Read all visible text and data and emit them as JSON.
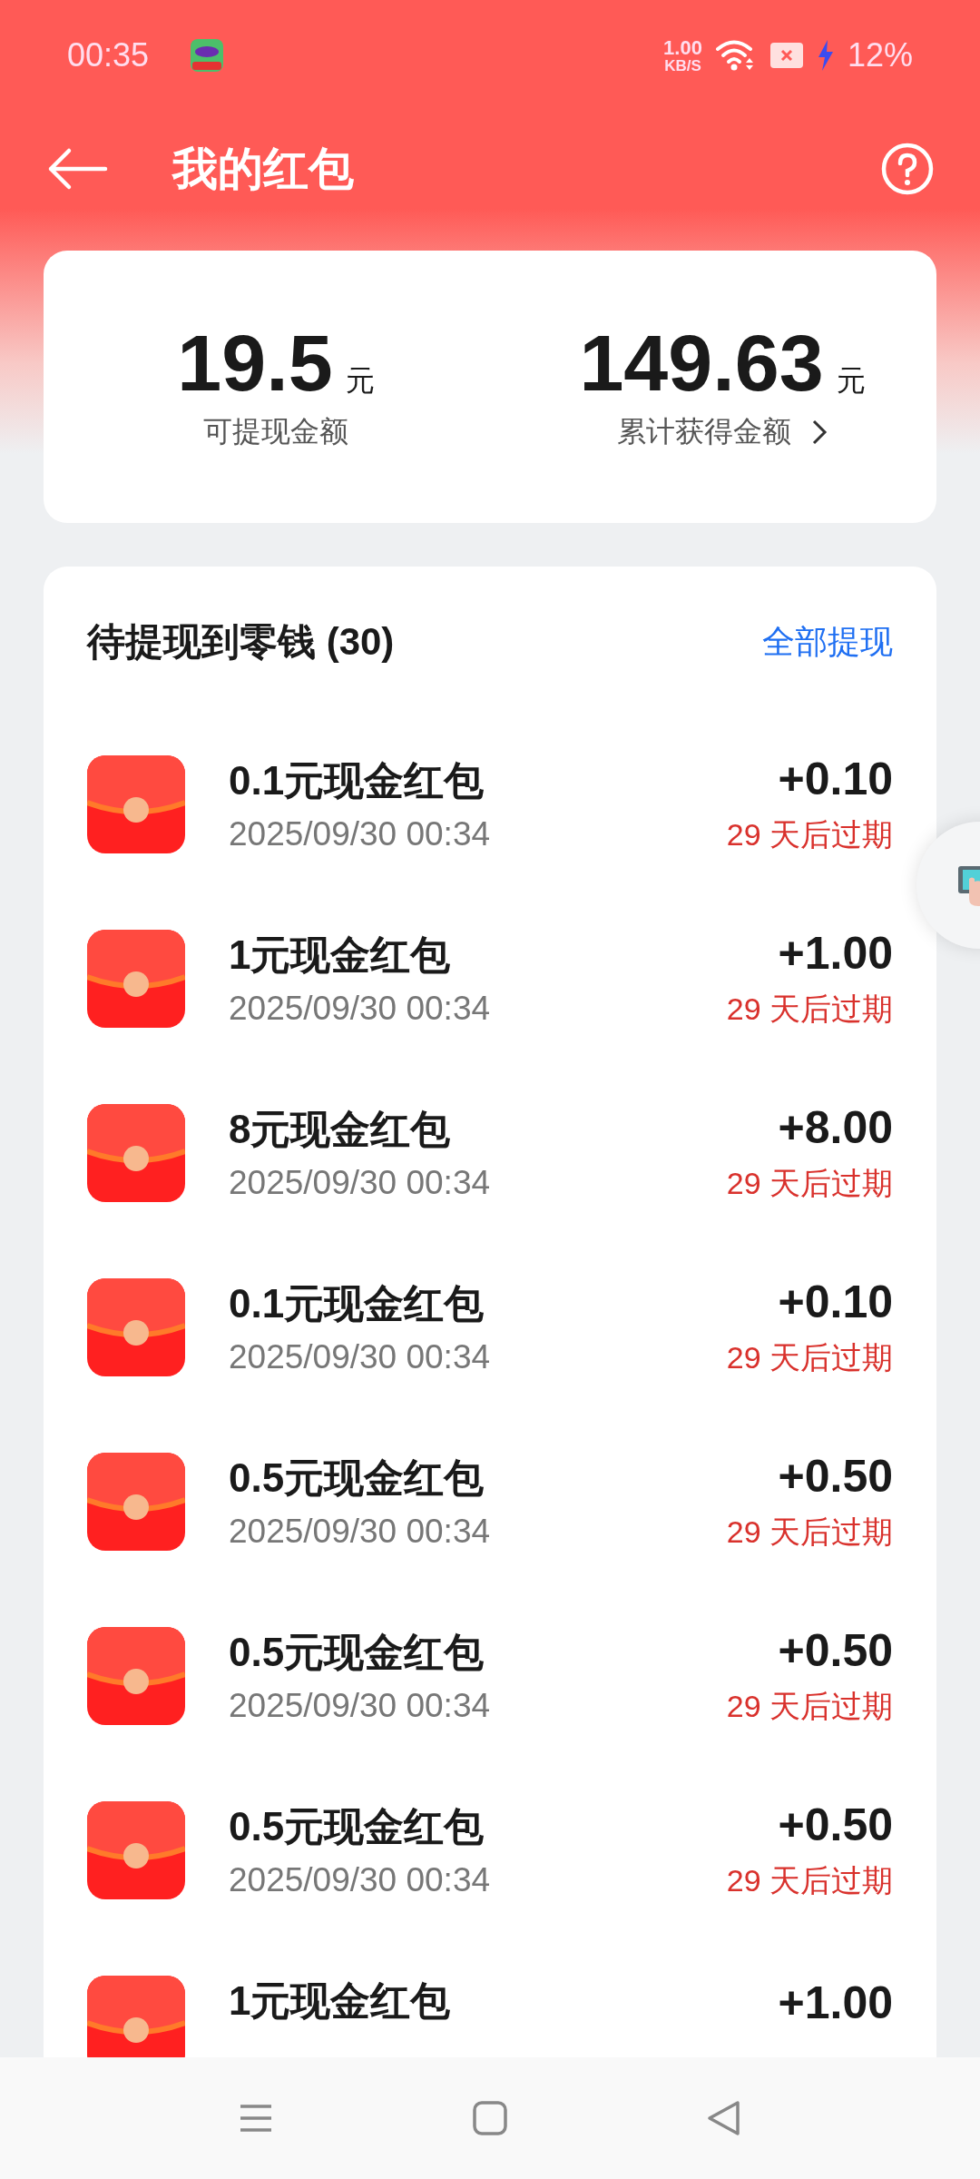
{
  "status_bar": {
    "time": "00:35",
    "net_speed": "1.00",
    "net_unit": "KB/S",
    "battery": "12%"
  },
  "header": {
    "title": "我的红包"
  },
  "summary": [
    {
      "amount": "19.5",
      "unit": "元",
      "label": "可提现金额",
      "has_arrow": false
    },
    {
      "amount": "149.63",
      "unit": "元",
      "label": "累计获得金额",
      "has_arrow": true
    }
  ],
  "pending": {
    "title": "待提现到零钱 (30)",
    "action": "全部提现",
    "items": [
      {
        "name": "0.1元现金红包",
        "time": "2025/09/30 00:34",
        "amount": "+0.10",
        "expiry": "29 天后过期"
      },
      {
        "name": "1元现金红包",
        "time": "2025/09/30 00:34",
        "amount": "+1.00",
        "expiry": "29 天后过期"
      },
      {
        "name": "8元现金红包",
        "time": "2025/09/30 00:34",
        "amount": "+8.00",
        "expiry": "29 天后过期"
      },
      {
        "name": "0.1元现金红包",
        "time": "2025/09/30 00:34",
        "amount": "+0.10",
        "expiry": "29 天后过期"
      },
      {
        "name": "0.5元现金红包",
        "time": "2025/09/30 00:34",
        "amount": "+0.50",
        "expiry": "29 天后过期"
      },
      {
        "name": "0.5元现金红包",
        "time": "2025/09/30 00:34",
        "amount": "+0.50",
        "expiry": "29 天后过期"
      },
      {
        "name": "0.5元现金红包",
        "time": "2025/09/30 00:34",
        "amount": "+0.50",
        "expiry": "29 天后过期"
      },
      {
        "name": "1元现金红包",
        "amount": "+1.00"
      }
    ]
  }
}
